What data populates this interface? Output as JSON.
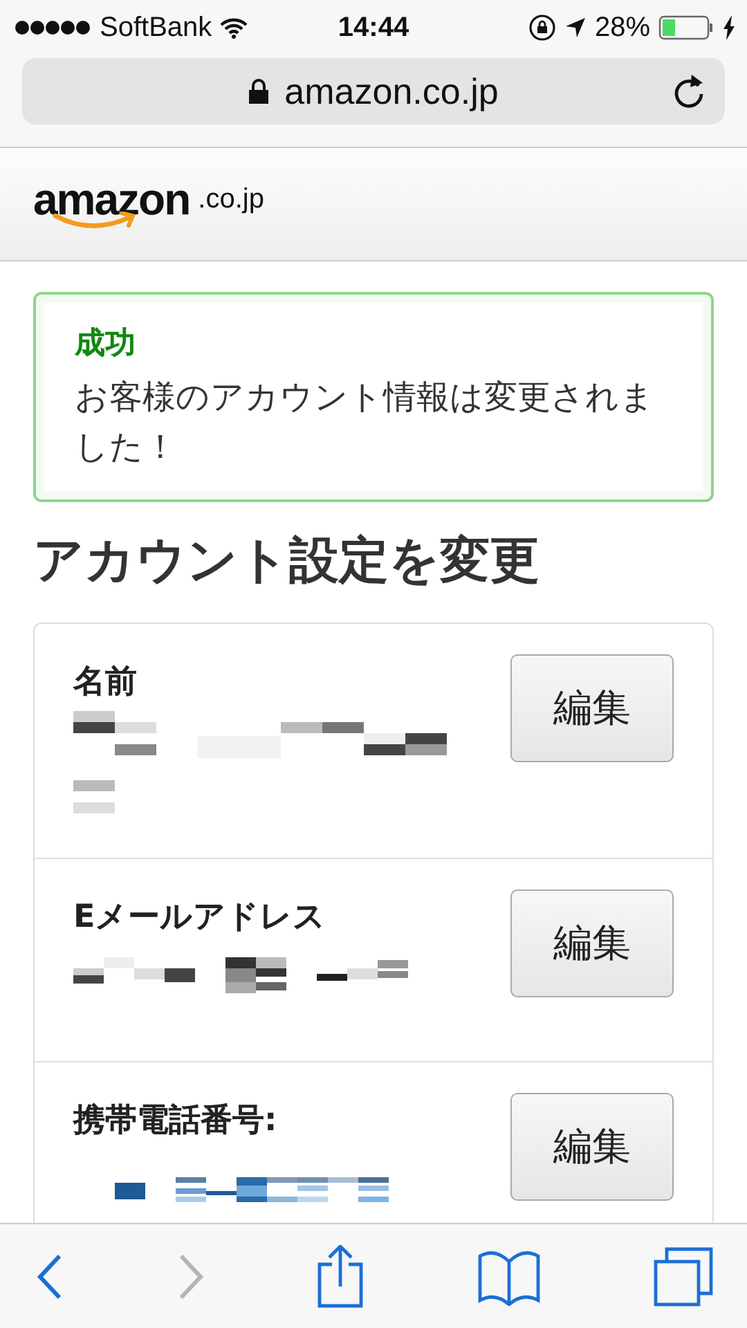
{
  "status_bar": {
    "carrier": "SoftBank",
    "time": "14:44",
    "battery": "28%"
  },
  "address_bar": {
    "url": "amazon.co.jp"
  },
  "header": {
    "logo": "amazon",
    "domain": ".co.jp"
  },
  "alert": {
    "title": "成功",
    "message": "お客様のアカウント情報は変更されました！"
  },
  "heading": "アカウント設定を変更",
  "settings": [
    {
      "label": "名前",
      "button": "編集",
      "kind": "name"
    },
    {
      "label": "Eメールアドレス",
      "button": "編集",
      "kind": "email"
    },
    {
      "label": "携帯電話番号:",
      "button": "編集",
      "kind": "phone"
    }
  ],
  "toolbar": [
    {
      "kind": "back",
      "disabled": false
    },
    {
      "kind": "forward",
      "disabled": true
    },
    {
      "kind": "share",
      "disabled": false
    },
    {
      "kind": "bookmarks",
      "disabled": false
    },
    {
      "kind": "tabs",
      "disabled": false
    }
  ]
}
